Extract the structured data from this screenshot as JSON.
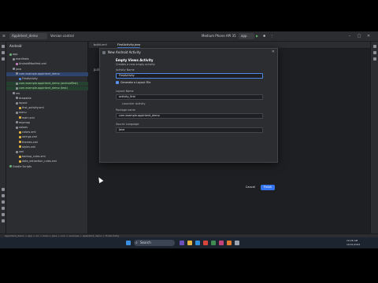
{
  "titlebar": {
    "project_label": "AppIntent_demo",
    "vcs_label": "Version control",
    "device_label": "Medium Phone API 35",
    "run_label": "app"
  },
  "project_panel": {
    "title": "Android",
    "tree": [
      {
        "label": "app",
        "state": "normal"
      },
      {
        "label": "manifests",
        "state": "normal"
      },
      {
        "label": "AndroidManifest.xml",
        "state": "normal"
      },
      {
        "label": "java",
        "state": "normal"
      },
      {
        "label": "com.example.appintent_demo",
        "state": "selected"
      },
      {
        "label": "FirstActivity",
        "state": "normal"
      },
      {
        "label": "com.example.appintent_demo (androidTest)",
        "state": "highlight"
      },
      {
        "label": "com.example.appintent_demo (test)",
        "state": "highlight"
      },
      {
        "label": "res",
        "state": "normal"
      },
      {
        "label": "drawable",
        "state": "normal"
      },
      {
        "label": "layout",
        "state": "normal"
      },
      {
        "label": "first_activity.xml",
        "state": "normal"
      },
      {
        "label": "menu",
        "state": "normal"
      },
      {
        "label": "main.xml",
        "state": "normal"
      },
      {
        "label": "mipmap",
        "state": "normal"
      },
      {
        "label": "values",
        "state": "normal"
      },
      {
        "label": "colors.xml",
        "state": "normal"
      },
      {
        "label": "strings.xml",
        "state": "normal"
      },
      {
        "label": "themes.xml",
        "state": "normal"
      },
      {
        "label": "styles.xml",
        "state": "normal"
      },
      {
        "label": "xml",
        "state": "normal"
      },
      {
        "label": "backup_rules.xml",
        "state": "normal"
      },
      {
        "label": "data_extraction_rules.xml",
        "state": "normal"
      },
      {
        "label": "Gradle Scripts",
        "state": "normal"
      }
    ]
  },
  "editor": {
    "tabs": [
      "build.xml",
      "FirstActivity.java"
    ],
    "lines": [
      "package com.example.appintent_demo;",
      "public class FirstActivity extends AppCompatActivity {"
    ]
  },
  "dialog": {
    "title": "New Android Activity",
    "heading": "Empty Views Activity",
    "subheading": "Creates a new empty activity",
    "activity_name_label": "Activity Name",
    "activity_name_value": "FirstActivity",
    "generate_layout_label": "Generate a Layout File",
    "layout_name_label": "Layout Name",
    "layout_name_value": "activity_first",
    "launcher_label": "Launcher Activity",
    "package_label": "Package name",
    "package_value": "com.example.appintent_demo",
    "language_label": "Source Language",
    "language_value": "Java",
    "cancel_label": "Cancel",
    "finish_label": "Finish"
  },
  "statusbar": {
    "path": "AppIntent_demo > app > src > main > java > com > example > appintent_demo > FirstActivity"
  },
  "taskbar": {
    "search_placeholder": "Search",
    "time": "10:26 AM",
    "date": "10/31/2024"
  },
  "colors": {
    "accent": "#3574f0",
    "ide_bg": "#1e1f22",
    "panel_bg": "#2b2d30"
  }
}
